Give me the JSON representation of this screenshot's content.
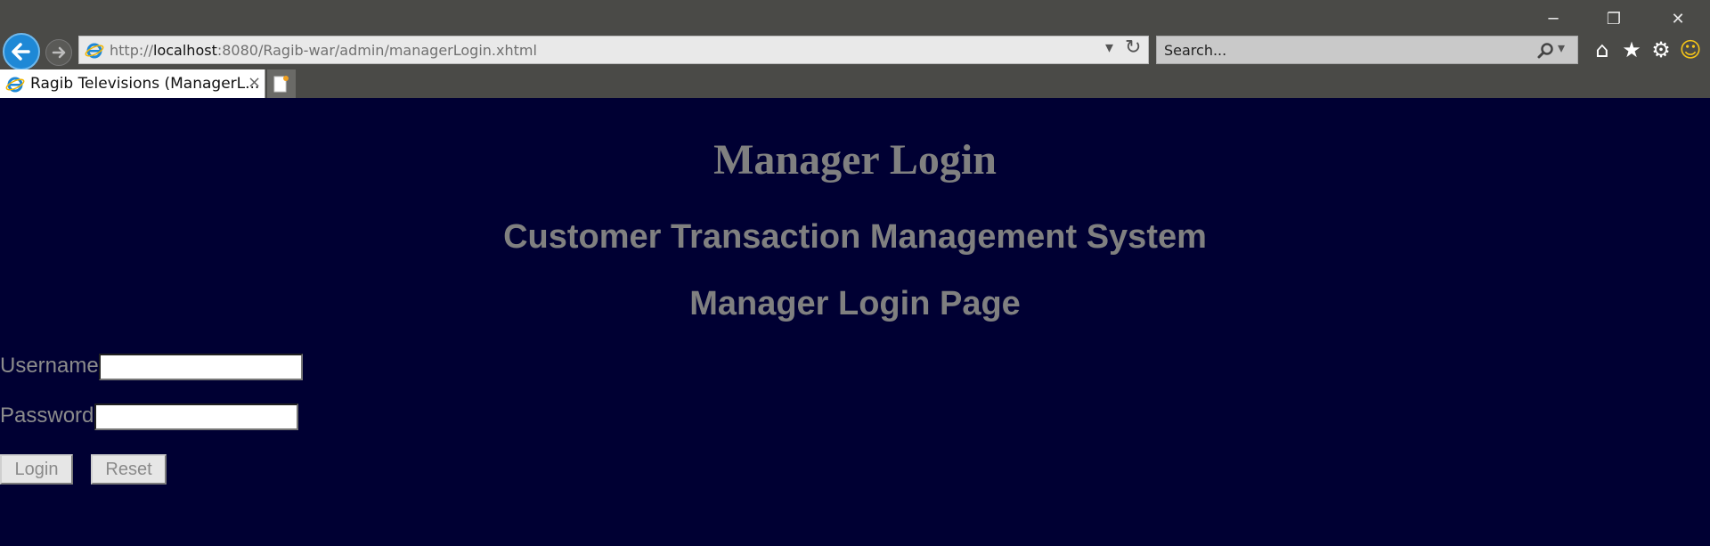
{
  "browser": {
    "address": {
      "prefix": "http://",
      "host": "localhost",
      "rest": ":8080/Ragib-war/admin/managerLogin.xhtml"
    },
    "search_placeholder": "Search...",
    "tab_title": "Ragib Televisions (ManagerL...",
    "tab_close": "×",
    "window_controls": {
      "minimize": "─",
      "restore": "❐",
      "close": "✕"
    },
    "icons": {
      "home": "⌂",
      "favorites": "★",
      "settings": "⚙",
      "feedback": "☺",
      "refresh": "↻",
      "dropdown": "▾",
      "search": "⚲",
      "back": "←",
      "forward": "→"
    }
  },
  "page": {
    "title": "Manager Login",
    "system_heading": "Customer Transaction Management System",
    "login_heading": "Manager Login Page",
    "username_label": "Username",
    "password_label": "Password",
    "username_value": "",
    "password_value": "",
    "login_button": "Login",
    "reset_button": "Reset"
  }
}
